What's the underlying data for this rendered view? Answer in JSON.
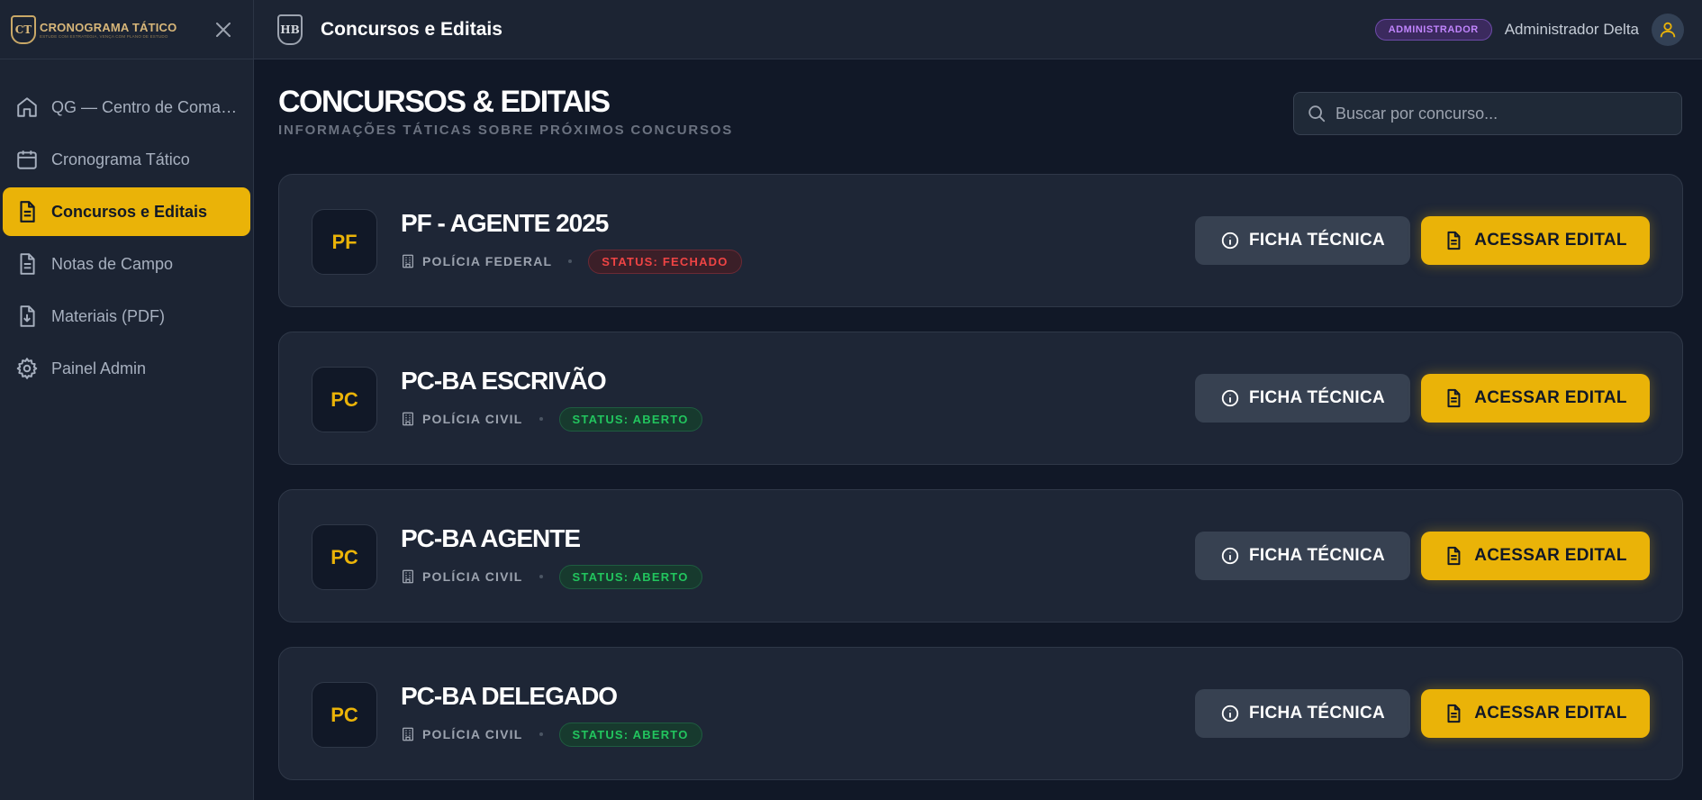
{
  "sidebar": {
    "logo_title": "CRONOGRAMA TÁTICO",
    "logo_subtitle": "ESTUDE COM ESTRATÉGIA, VENÇA COM PLANO DE ESTUDO",
    "logo_mark": "CT",
    "items": [
      {
        "label": "QG — Centro de Comando",
        "icon": "home-icon",
        "active": false
      },
      {
        "label": "Cronograma Tático",
        "icon": "calendar-icon",
        "active": false
      },
      {
        "label": "Concursos e Editais",
        "icon": "document-icon",
        "active": true
      },
      {
        "label": "Notas de Campo",
        "icon": "notes-icon",
        "active": false
      },
      {
        "label": "Materiais (PDF)",
        "icon": "file-download-icon",
        "active": false
      },
      {
        "label": "Painel Admin",
        "icon": "gear-icon",
        "active": false
      }
    ]
  },
  "topbar": {
    "logo_mark": "HB",
    "title": "Concursos e Editais",
    "role": "ADMINISTRADOR",
    "user": "Administrador Delta"
  },
  "main": {
    "title": "CONCURSOS & EDITAIS",
    "subtitle": "INFORMAÇÕES TÁTICAS SOBRE PRÓXIMOS CONCURSOS",
    "search_placeholder": "Buscar por concurso...",
    "ficha_label": "FICHA TÉCNICA",
    "edital_label": "ACESSAR EDITAL",
    "cards": [
      {
        "code": "PF",
        "title": "PF - AGENTE 2025",
        "org": "POLÍCIA FEDERAL",
        "status": "STATUS: FECHADO",
        "status_type": "closed"
      },
      {
        "code": "PC",
        "title": "PC-BA ESCRIVÃO",
        "org": "POLÍCIA CIVIL",
        "status": "STATUS: ABERTO",
        "status_type": "open"
      },
      {
        "code": "PC",
        "title": "PC-BA AGENTE",
        "org": "POLÍCIA CIVIL",
        "status": "STATUS: ABERTO",
        "status_type": "open"
      },
      {
        "code": "PC",
        "title": "PC-BA DELEGADO",
        "org": "POLÍCIA CIVIL",
        "status": "STATUS: ABERTO",
        "status_type": "open"
      }
    ]
  },
  "colors": {
    "accent": "#eab308",
    "background": "#111827",
    "panel": "#1c2433",
    "status_closed": "#ef4444",
    "status_open": "#22c55e",
    "role_badge": "#c084fc"
  }
}
